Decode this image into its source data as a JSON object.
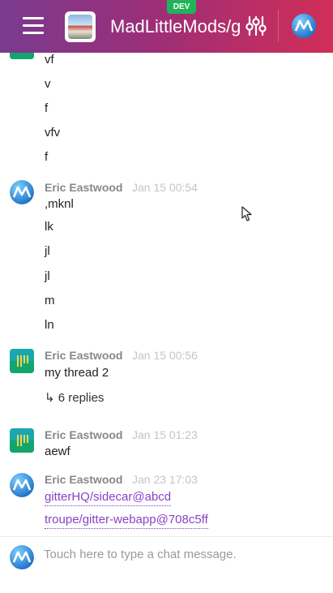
{
  "header": {
    "room_title": "MadLittleMods/gitter",
    "dev_badge": "DEV"
  },
  "messages_top": {
    "lines": [
      "vf",
      "v",
      "f",
      "vfv",
      "f"
    ]
  },
  "groups": [
    {
      "author": "Eric Eastwood",
      "time": "Jan 15 00:54",
      "avatar": "gitter-m-avatar",
      "lines": [
        ",mknl",
        "lk",
        "jl",
        "jl",
        "m",
        "ln"
      ]
    },
    {
      "author": "Eric Eastwood",
      "time": "Jan 15 00:56",
      "avatar": "gitter-bars-avatar",
      "lines": [
        "my thread 2"
      ],
      "replies": "↳ 6 replies"
    },
    {
      "author": "Eric Eastwood",
      "time": "Jan 15 01:23",
      "avatar": "gitter-bars-avatar",
      "lines": [
        "aewf"
      ]
    },
    {
      "author": "Eric Eastwood",
      "time": "Jan 23 17:03",
      "avatar": "gitter-m-avatar",
      "links": [
        "gitterHQ/sidecar@abcd",
        "troupe/gitter-webapp@708c5ff"
      ]
    }
  ],
  "composer": {
    "placeholder": "Touch here to type a chat message."
  },
  "colors": {
    "header_start": "#7a3b8f",
    "header_end": "#d12e57",
    "link": "#8a42c7",
    "dev_badge": "#1fb35a"
  }
}
